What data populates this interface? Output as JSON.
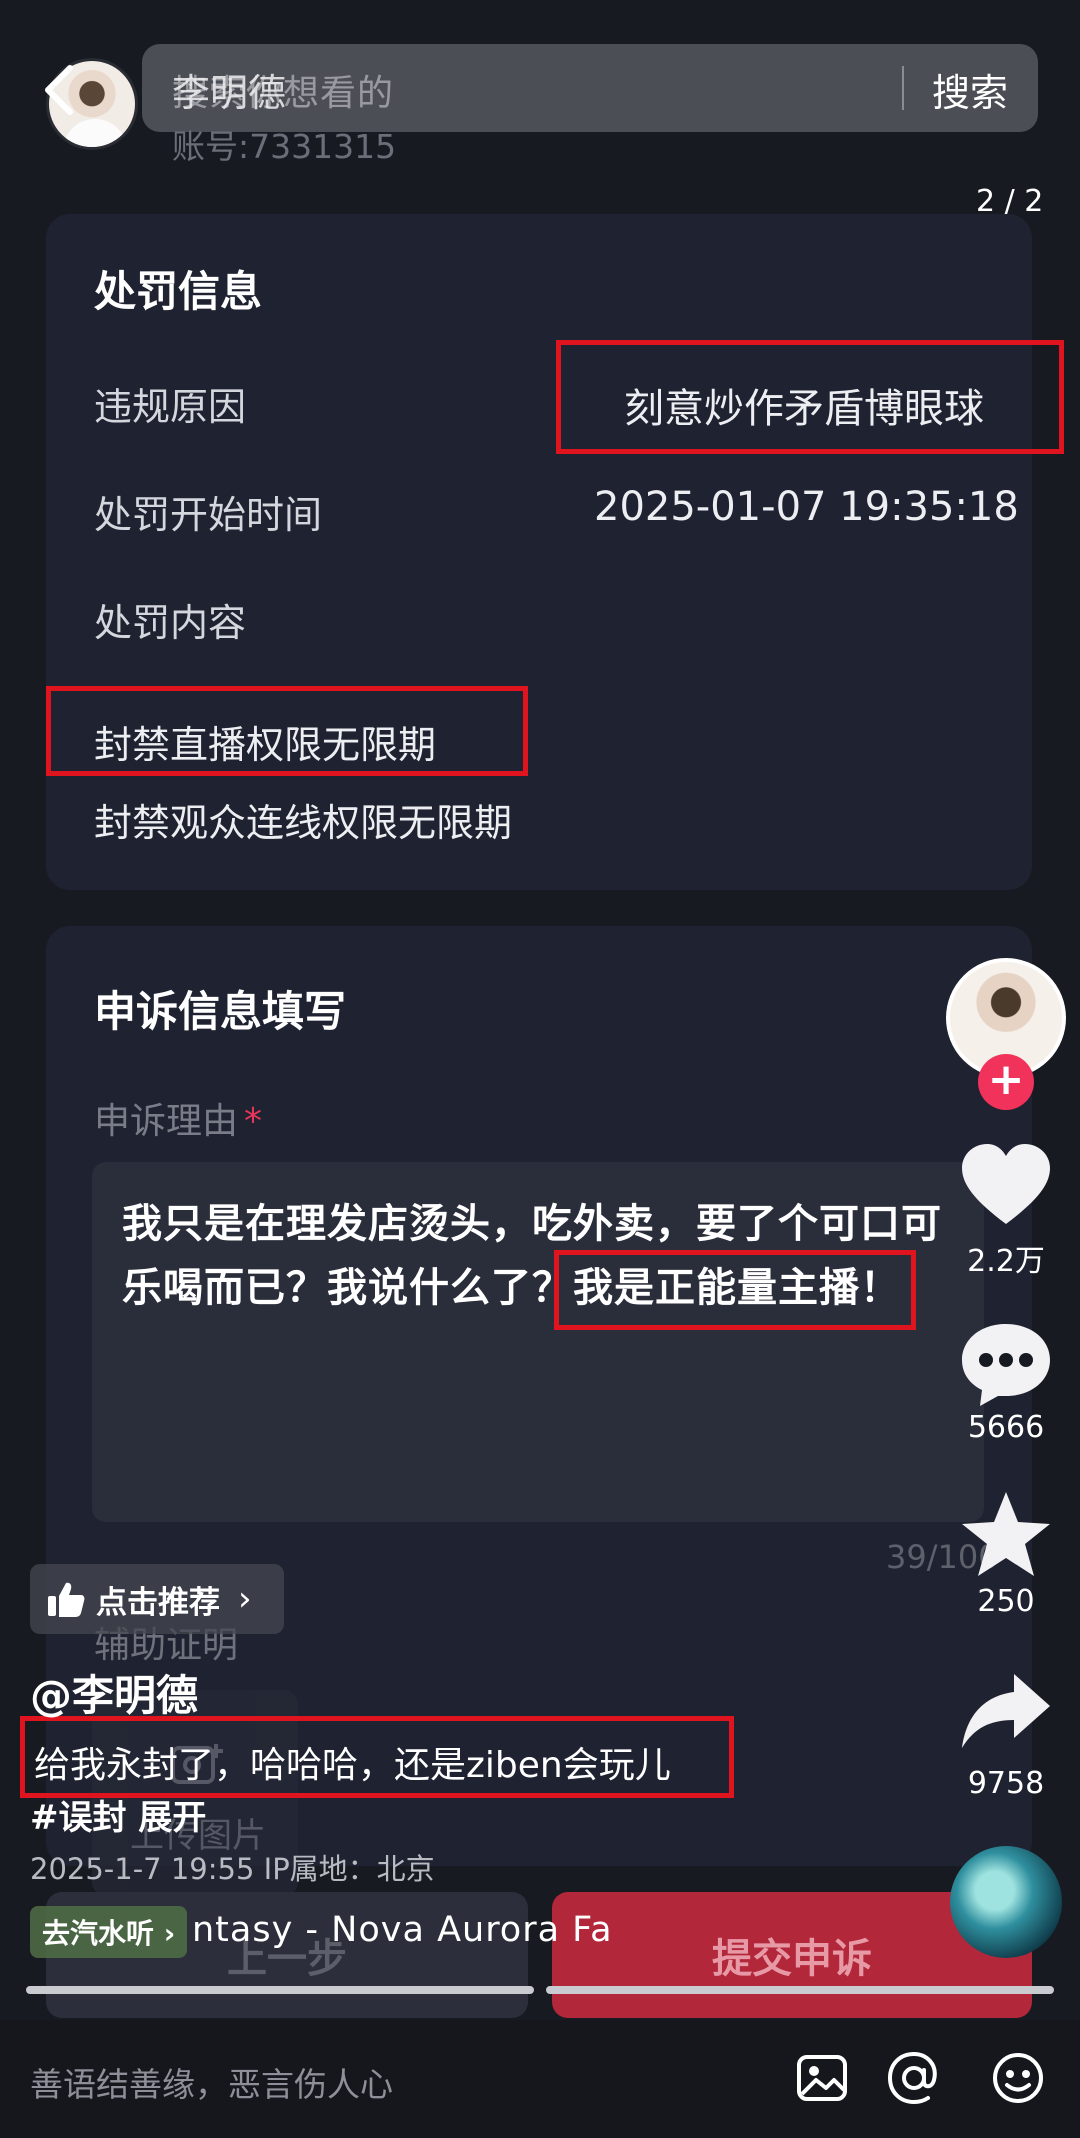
{
  "top": {
    "search_placeholder": "搜索你想看的",
    "username": "李明德",
    "search_button": "搜索",
    "account_id": "账号:7331315",
    "page_indicator": "2 / 2"
  },
  "penalty": {
    "title": "处罚信息",
    "reason_label": "违规原因",
    "reason_value": "刻意炒作矛盾博眼球",
    "start_label": "处罚开始时间",
    "start_value": "2025-01-07 19:35:18",
    "content_label": "处罚内容",
    "items": [
      "封禁直播权限无限期",
      "封禁观众连线权限无限期"
    ]
  },
  "appeal": {
    "title": "申诉信息填写",
    "reason_field_label": "申诉理由",
    "required_mark": "*",
    "text": "我只是在理发店烫头，吃外卖，要了个可口可乐喝而已？我说什么了？我是正能量主播！",
    "char_count": "39/100",
    "assist_label": "辅助证明",
    "upload_label": "上传图片",
    "prev_button": "上一步",
    "submit_button": "提交申诉"
  },
  "rail": {
    "like_count": "2.2万",
    "comment_count": "5666",
    "favorite_count": "250",
    "share_count": "9758",
    "follow_badge": "+"
  },
  "video": {
    "recommend_label": "点击推荐",
    "author": "@李明德",
    "caption": "给我永封了，哈哈哈，还是ziben会玩儿",
    "hashtags": "#误封  展开",
    "meta": "2025-1-7 19:55  IP属地：北京",
    "music_chip": "去汽水听 ›",
    "music_title": "ntasy  -  Nova Aurora   Fa"
  },
  "comment_bar": {
    "placeholder": "善语结善缘，恶言伤人心"
  },
  "colors": {
    "background": "#181a22",
    "card": "#1f2230",
    "highlight_box": "#e0141e",
    "submit": "#b3273b",
    "follow": "#f1325b"
  }
}
